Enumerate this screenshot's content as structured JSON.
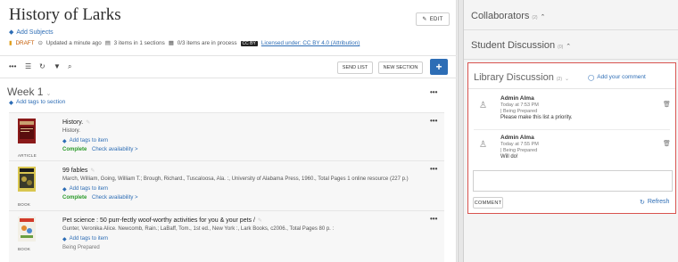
{
  "page": {
    "title": "History of Larks",
    "edit_label": "EDIT",
    "add_subjects": "Add Subjects",
    "meta": {
      "status": "DRAFT",
      "updated": "Updated a minute ago",
      "items": "3 items in 1 sections",
      "process": "0/3 items are in process",
      "cc_badge": "CC BY",
      "license": "Licensed under: CC BY 4.0 (Attribution)"
    }
  },
  "toolbar": {
    "send_list": "SEND LIST",
    "new_section": "NEW SECTION",
    "icons": [
      "ellipsis-icon",
      "list-icon",
      "refresh-icon",
      "filter-icon",
      "search-icon",
      "plus-icon"
    ]
  },
  "section": {
    "title": "Week 1",
    "add_tags": "Add tags to section"
  },
  "items": [
    {
      "title": "History.",
      "subtitle": "History.",
      "type": "ARTICLE",
      "add_tags": "Add tags to item",
      "status": "Complete",
      "availability": "Check availability >"
    },
    {
      "title": "99 fables",
      "subtitle": "March, William, Going, William T.; Brough, Richard., Tuscaloosa, Ala. :, University of Alabama Press, 1960., Total Pages 1 online resource (227 p.)",
      "type": "BOOK",
      "add_tags": "Add tags to item",
      "status": "Complete",
      "availability": "Check availability >"
    },
    {
      "title": "Pet science : 50 purr-fectly woof-worthy activities for you & your pets /",
      "subtitle": "Gunter, Veronika Alice. Newcomb, Rain.; LaBaff, Tom., 1st ed., New York :, Lark Books, c2006., Total Pages 80 p. :",
      "type": "BOOK",
      "add_tags": "Add tags to item",
      "status": "Being Prepared"
    }
  ],
  "sidebar": {
    "collaborators": "Collaborators",
    "collaborators_count": "(2)",
    "student_discussion": "Student Discussion",
    "student_discussion_count": "(0)",
    "library_discussion": "Library Discussion",
    "library_discussion_count": "(2)",
    "add_comment": "Add your comment",
    "comments": [
      {
        "author": "Admin Alma",
        "time": "Today at 7:53 PM",
        "state": "| Being Prepared",
        "text": "Please make this list a priority."
      },
      {
        "author": "Admin Alma",
        "time": "Today at 7:55 PM",
        "state": "| Being Prepared",
        "text": "Will do!"
      }
    ],
    "comment_button": "COMMENT",
    "refresh": "Refresh"
  },
  "colors": {
    "accent": "#2d6db5",
    "complete": "#2a9a2a",
    "draft": "#c45a00",
    "highlight_border": "#d9534f"
  }
}
